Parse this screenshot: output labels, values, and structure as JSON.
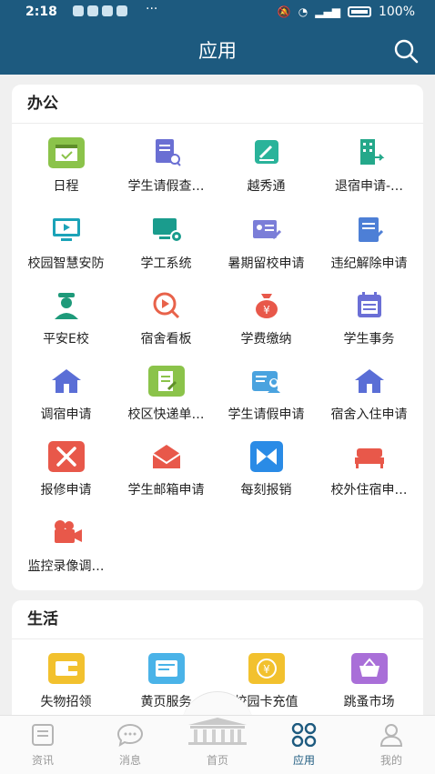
{
  "status": {
    "time": "2:18",
    "dots": "···",
    "battery": "100%"
  },
  "header": {
    "title": "应用"
  },
  "office": {
    "title": "办公",
    "items": [
      {
        "label": "日程"
      },
      {
        "label": "学生请假查…"
      },
      {
        "label": "越秀通"
      },
      {
        "label": "退宿申请-…"
      },
      {
        "label": "校园智慧安防"
      },
      {
        "label": "学工系统"
      },
      {
        "label": "暑期留校申请"
      },
      {
        "label": "违纪解除申请"
      },
      {
        "label": "平安E校"
      },
      {
        "label": "宿舍看板"
      },
      {
        "label": "学费缴纳"
      },
      {
        "label": "学生事务"
      },
      {
        "label": "调宿申请"
      },
      {
        "label": "校区快递单…"
      },
      {
        "label": "学生请假申请"
      },
      {
        "label": "宿舍入住申请"
      },
      {
        "label": "报修申请"
      },
      {
        "label": "学生邮箱申请"
      },
      {
        "label": "每刻报销"
      },
      {
        "label": "校外住宿申…"
      },
      {
        "label": "监控录像调…"
      }
    ]
  },
  "life": {
    "title": "生活",
    "items": [
      {
        "label": "失物招领"
      },
      {
        "label": "黄页服务"
      },
      {
        "label": "校园卡充值"
      },
      {
        "label": "跳蚤市场"
      }
    ]
  },
  "tabs": [
    {
      "label": "资讯"
    },
    {
      "label": "消息"
    },
    {
      "label": "首页"
    },
    {
      "label": "应用"
    },
    {
      "label": "我的"
    }
  ],
  "colors": {
    "brand": "#1d5a7f",
    "active_tab": "#1d5a7f"
  }
}
